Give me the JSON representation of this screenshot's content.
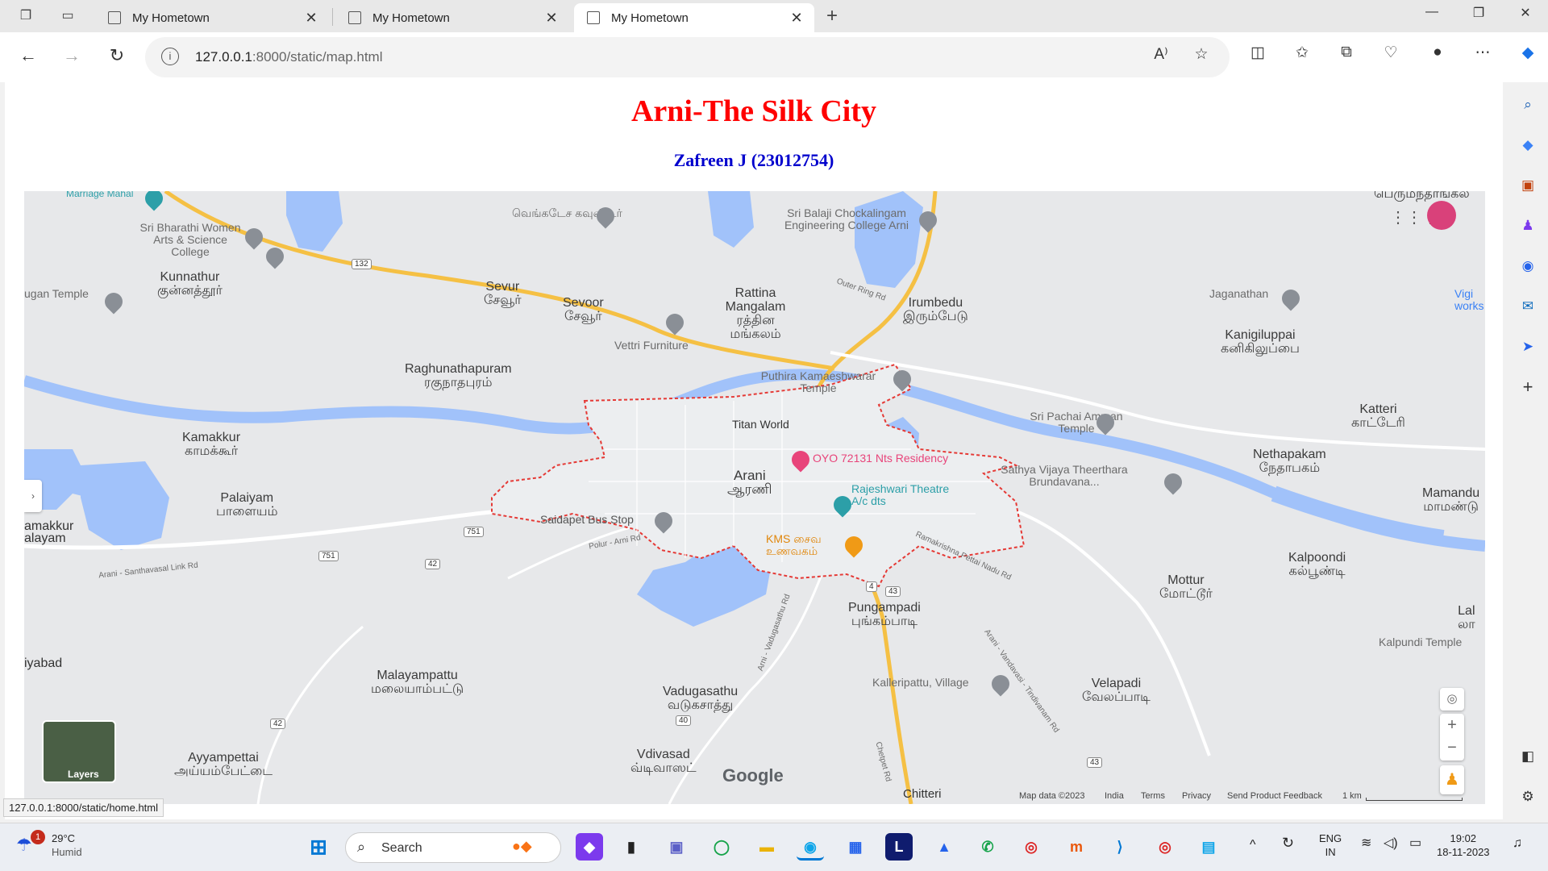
{
  "browser": {
    "tabs": [
      {
        "label": "My Hometown"
      },
      {
        "label": "My Hometown"
      },
      {
        "label": "My Hometown"
      }
    ],
    "url_host": "127.0.0.1",
    "url_path": ":8000/static/map.html",
    "status_url": "127.0.0.1:8000/static/home.html"
  },
  "page": {
    "title": "Arni-The Silk City",
    "subtitle": "Zafreen J (23012754)"
  },
  "map": {
    "towns": [
      {
        "en": "Kunnathur",
        "ta": "குன்னத்தூர்"
      },
      {
        "en": "Sevur",
        "ta": "சேவூர்"
      },
      {
        "en": "Sevoor",
        "ta": "சேவூர்"
      },
      {
        "en": "Rattina Mangalam",
        "ta": "ரத்தின மங்கலம்"
      },
      {
        "en": "Irumbedu",
        "ta": "இரும்பேடு"
      },
      {
        "en": "Kanigiluppai",
        "ta": "கனிகிலுப்பை"
      },
      {
        "en": "Raghunathapuram",
        "ta": "ரகுநாதபுரம்"
      },
      {
        "en": "Kamakkur",
        "ta": "காமக்கூர்"
      },
      {
        "en": "Katteri",
        "ta": "காட்டேரி"
      },
      {
        "en": "Nethapakam",
        "ta": "நேதாபகம்"
      },
      {
        "en": "Palaiyam",
        "ta": "பாளையம்"
      },
      {
        "en": "Arani",
        "ta": "ஆரணி"
      },
      {
        "en": "Kalpoondi",
        "ta": "கல்பூண்டி"
      },
      {
        "en": "Mottur",
        "ta": "மோட்டூர்"
      },
      {
        "en": "Pungampadi",
        "ta": "புங்கம்பாடி"
      },
      {
        "en": "Malayampattu",
        "ta": "மலையாம்பட்டு"
      },
      {
        "en": "Vadugasathu",
        "ta": "வடுகசாத்து"
      },
      {
        "en": "Velapadi",
        "ta": "வேலப்பாடி"
      },
      {
        "en": "Ayyampettai",
        "ta": "அய்யம்பேட்டை"
      },
      {
        "en": "Vdivasad",
        "ta": "வ்டிவாஸட்"
      },
      {
        "en": "Mamandu",
        "ta": "மாமண்டு"
      },
      {
        "en": "Lal",
        "ta": "லா"
      }
    ],
    "pois": {
      "sri_bharathi": "Sri Bharathi Women Arts & Science College",
      "sri_balaji": "Sri Balaji Chockalingam Engineering College Arni",
      "venkatesa": "வெங்கடேச கவுண்டர்",
      "jaganathan": "Jaganathan",
      "vettri": "Vettri Furniture",
      "puthira": "Puthira Kamaeshwarar Temple",
      "sri_pachai": "Sri Pachai Amman Temple",
      "titan": "Titan World",
      "oyo": "OYO 72131 Nts Residency",
      "sathya": "Sathya Vijaya Theerthara Brundavana...",
      "rajeshwari": "Rajeshwari Theatre A/c dts",
      "saidapet": "Saidapet Bus Stop",
      "kms": "KMS சைவ உணவகம்",
      "kalleripattu": "Kalleripattu, Village",
      "kalpundi": "Kalpundi Temple",
      "marriage": "Marriage Mahal",
      "ugan": "ugan Temple",
      "perumanthangal": "பெருமந்தாங்கல",
      "chitteri": "Chitteri",
      "iyabad": "iyabad",
      "amakkur": "amakkur alayam",
      "vigi": "Vigi works"
    },
    "roads": {
      "outer_ring": "Outer Ring Rd",
      "polur_arni": "Polur - Arni Rd",
      "santhavasal": "Arani - Santhavasal Link Rd",
      "ramakrishna": "Ramakrishna Pettai Nadu Rd",
      "vandavasi": "Arani - Vandavasi - Tindivanam Rd",
      "chetpet": "Chetpet Rd",
      "vadugasathu_rd": "Arni - Vadugasathu Rd"
    },
    "road_shields": [
      "132",
      "751",
      "751",
      "42",
      "42",
      "4",
      "43",
      "40",
      "43"
    ],
    "layers_label": "Layers",
    "google": "Google",
    "attribution": [
      "Map data ©2023",
      "India",
      "Terms",
      "Privacy",
      "Send Product Feedback",
      "1 km"
    ]
  },
  "taskbar": {
    "weather_temp": "29°C",
    "weather_desc": "Humid",
    "weather_badge": "1",
    "search": "Search",
    "lang1": "ENG",
    "lang2": "IN",
    "time": "19:02",
    "date": "18-11-2023"
  },
  "colors": {
    "title": "#ff0000",
    "subtitle": "#0000cd",
    "water": "#a1c2fa",
    "highway": "#f5c044",
    "boundary": "#e53935"
  }
}
